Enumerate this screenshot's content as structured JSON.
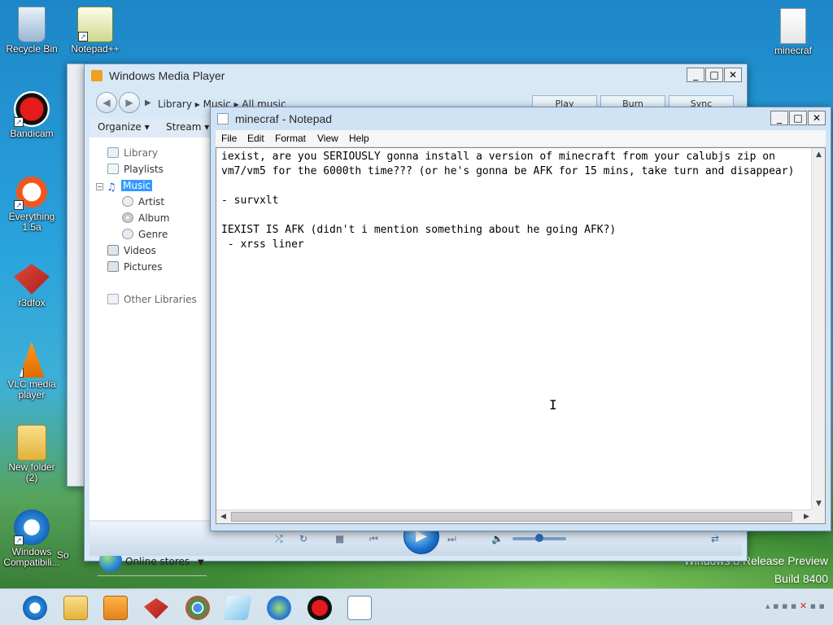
{
  "desktop": {
    "icons_left": [
      {
        "label": "Recycle Bin",
        "icon": "recycle-bin-icon"
      },
      {
        "label": "Notepad++",
        "icon": "notepadpp-icon"
      },
      {
        "label": "Bandicam",
        "icon": "bandicam-icon"
      },
      {
        "label": "Everything 1.5a",
        "icon": "everything-icon"
      },
      {
        "label": "r3dfox",
        "icon": "r3dfox-icon"
      },
      {
        "label": "VLC media player",
        "icon": "vlc-icon"
      },
      {
        "label": "New folder (2)",
        "icon": "folder-icon"
      },
      {
        "label": "Windows Compatibili...",
        "icon": "ie-icon"
      },
      {
        "label": "So",
        "icon": "partial-icon"
      }
    ],
    "icon_right": {
      "label": "minecraf",
      "icon": "text-file-icon"
    },
    "watermark_line1": "Windows 8 Release Preview",
    "watermark_line2": "Build 8400"
  },
  "wmp": {
    "title": "Windows Media Player",
    "breadcrumb": "Library  ▸  Music  ▸  All music",
    "tabs": [
      "Play",
      "Burn",
      "Sync"
    ],
    "commands": {
      "organize": "Organize",
      "stream": "Stream"
    },
    "tree": {
      "library": "Library",
      "playlists": "Playlists",
      "music": "Music",
      "artist": "Artist",
      "album": "Album",
      "genre": "Genre",
      "videos": "Videos",
      "pictures": "Pictures",
      "other_libraries": "Other Libraries"
    },
    "online_stores": "Online stores"
  },
  "notepad": {
    "title": "minecraf - Notepad",
    "menus": [
      "File",
      "Edit",
      "Format",
      "View",
      "Help"
    ],
    "content": "iexist, are you SERIOUSLY gonna install a version of minecraft from your calubjs zip on\nvm7/vm5 for the 6000th time??? (or he's gonna be AFK for 15 mins, take turn and disappear)\n\n- survxlt\n\nIEXIST IS AFK (didn't i mention something about he going AFK?)\n - xrss liner"
  },
  "taskbar": {
    "apps": [
      "ie-icon",
      "explorer-icon",
      "media-player-icon",
      "r3dfox-icon",
      "chrome-icon",
      "notepad-icon",
      "idm-icon",
      "bandicam-icon",
      "list-icon"
    ]
  },
  "colors": {
    "accent": "#3399ff",
    "desktop": "#2aa3dd"
  }
}
